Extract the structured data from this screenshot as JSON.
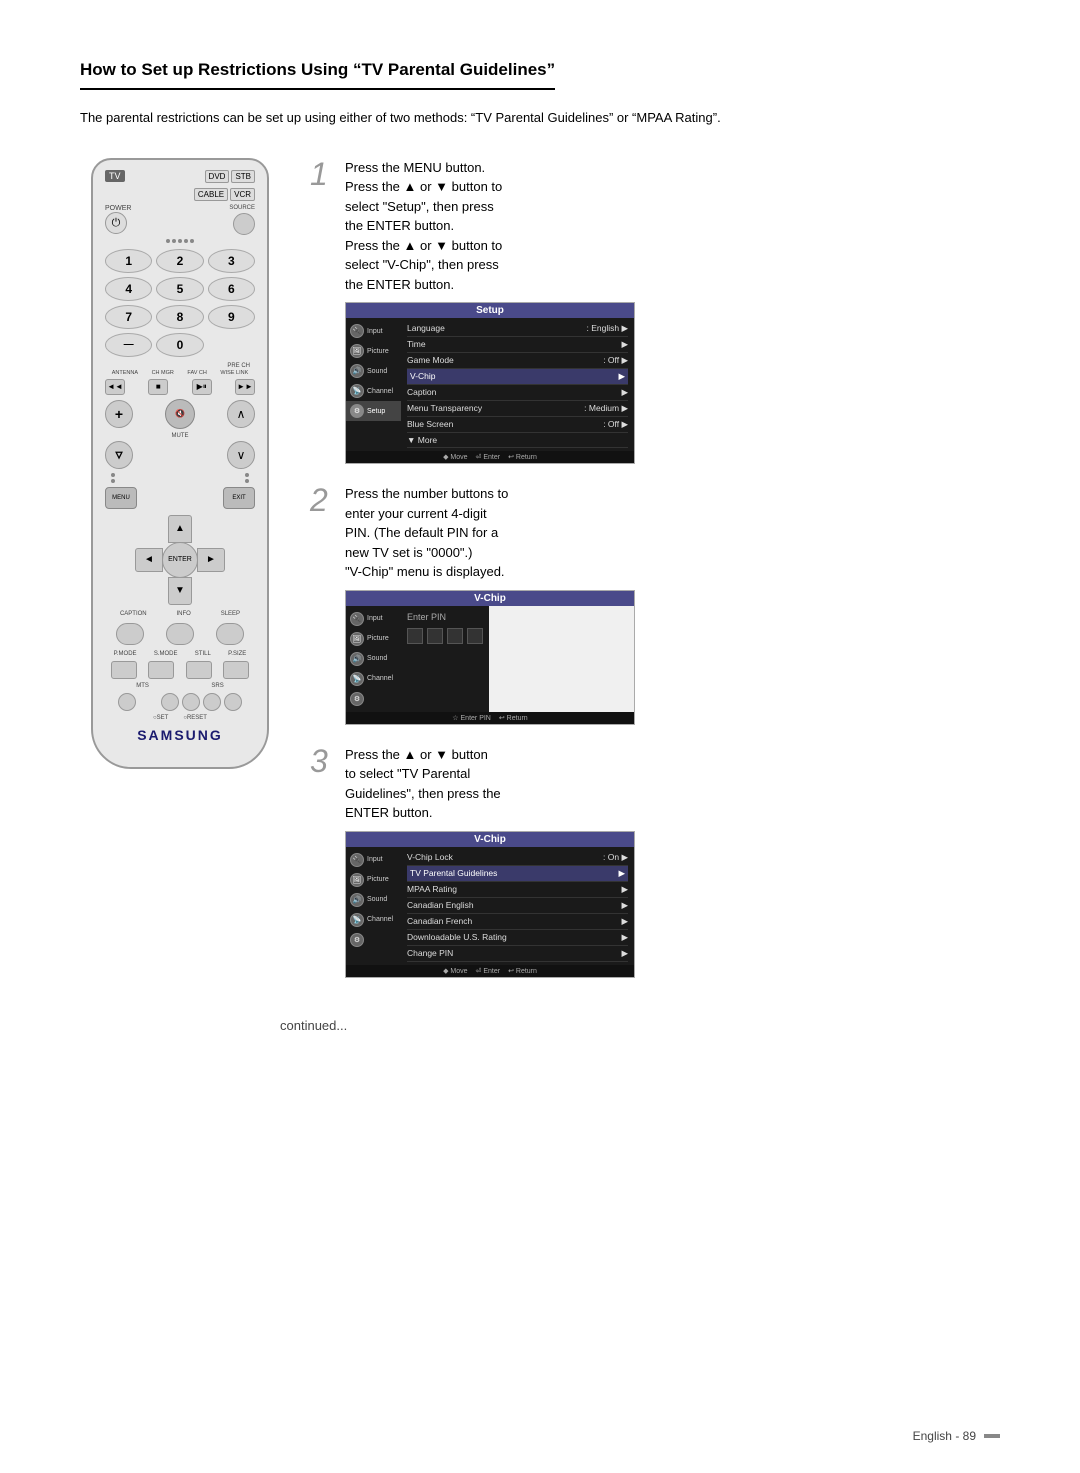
{
  "page": {
    "title": "How to Set up Restrictions Using “TV Parental Guidelines”",
    "intro": "The parental restrictions can be set up using either of two methods: “TV Parental Guidelines” or “MPAA Rating”.",
    "page_number": "English - 89",
    "continued": "continued..."
  },
  "steps": [
    {
      "number": "1",
      "text_lines": [
        "Press the MENU button.",
        "Press the ▲ or ▼ button to",
        "select “Setup”, then press",
        "the ENTER button.",
        "Press the ▲ or ▼ button to",
        "select “V-Chip”, then press",
        "the ENTER button."
      ],
      "screen": {
        "header": "Setup",
        "sidebar": [
          "Input",
          "Picture",
          "Sound",
          "Channel",
          "Setup"
        ],
        "menu_items": [
          {
            "label": "Language",
            "value": ": English",
            "arrow": true
          },
          {
            "label": "Time",
            "value": "",
            "arrow": true
          },
          {
            "label": "Game Mode",
            "value": ": Off",
            "arrow": true
          },
          {
            "label": "V-Chip",
            "value": "",
            "arrow": true,
            "highlight": true
          },
          {
            "label": "Caption",
            "value": "",
            "arrow": true
          },
          {
            "label": "Menu Transparency",
            "value": ": Medium",
            "arrow": true
          },
          {
            "label": "Blue Screen",
            "value": ": Off",
            "arrow": true
          },
          {
            "label": "▼ More",
            "value": "",
            "arrow": false
          }
        ],
        "footer": "◆ Move  ⏎ Enter  ↩ Return"
      }
    },
    {
      "number": "2",
      "text_lines": [
        "Press the number buttons to",
        "enter your current 4-digit",
        "PIN. (The default PIN for a",
        "new TV set is “0000”.)",
        "“V-Chip” menu is displayed."
      ],
      "screen": {
        "header": "V-Chip",
        "type": "pin",
        "sidebar": [
          "Input",
          "Picture",
          "Sound",
          "Channel",
          "Setup"
        ],
        "enter_pin": "Enter PIN",
        "pin_count": 4,
        "footer": "☆ Enter PIN  ↩ Return"
      }
    },
    {
      "number": "3",
      "text_lines": [
        "Press the ▲ or ▼ button",
        "to select “TV Parental",
        "Guidelines”, then press the",
        "ENTER button."
      ],
      "screen": {
        "header": "V-Chip",
        "sidebar": [
          "Input",
          "Picture",
          "Sound",
          "Channel",
          "Setup"
        ],
        "menu_items": [
          {
            "label": "V-Chip Lock",
            "value": ": On",
            "arrow": true
          },
          {
            "label": "TV Parental Guidelines",
            "value": "",
            "arrow": true,
            "highlight": true
          },
          {
            "label": "MPAA Rating",
            "value": "",
            "arrow": true
          },
          {
            "label": "Canadian English",
            "value": "",
            "arrow": true
          },
          {
            "label": "Canadian French",
            "value": "",
            "arrow": true
          },
          {
            "label": "Downloadable U.S. Rating",
            "value": "",
            "arrow": true
          },
          {
            "label": "Change PIN",
            "value": "",
            "arrow": true
          }
        ],
        "footer": "◆ Move  ⏎ Enter  ↩ Return"
      }
    }
  ],
  "remote": {
    "buttons": {
      "tv": "TV",
      "dvd": "DVD",
      "stb": "STB",
      "cable": "CABLE",
      "vcr": "VCR",
      "power": "⏻",
      "source": "SOURCE",
      "numbers": [
        "1",
        "2",
        "3",
        "4",
        "5",
        "6",
        "7",
        "8",
        "9",
        "-",
        "0"
      ],
      "pre_ch": "PRE CH",
      "antenna": "ANTENNA",
      "ch_mgr": "CH MGR",
      "fav_ch": "FAV CH",
      "wise_link": "WISE LINK",
      "rew": "◄◄",
      "stop": "■",
      "play_pause": "▶⏸",
      "ff": "►►",
      "vol_up": "+",
      "vol_down": "",
      "ch_up": "∧",
      "ch_down": "∨",
      "mute": "MUTE",
      "menu": "MENU",
      "exit": "EXIT",
      "enter": "ENTER",
      "caption": "CAPTION",
      "info": "INFO",
      "sleep": "SLEEP",
      "p_mode": "P.MODE",
      "s_mode": "S.MODE",
      "still": "STILL",
      "p_size": "P.SIZE",
      "mts": "MTS",
      "srs": "SRS",
      "set": "SET",
      "reset": "RESET",
      "samsung": "SAMSUNG"
    }
  }
}
